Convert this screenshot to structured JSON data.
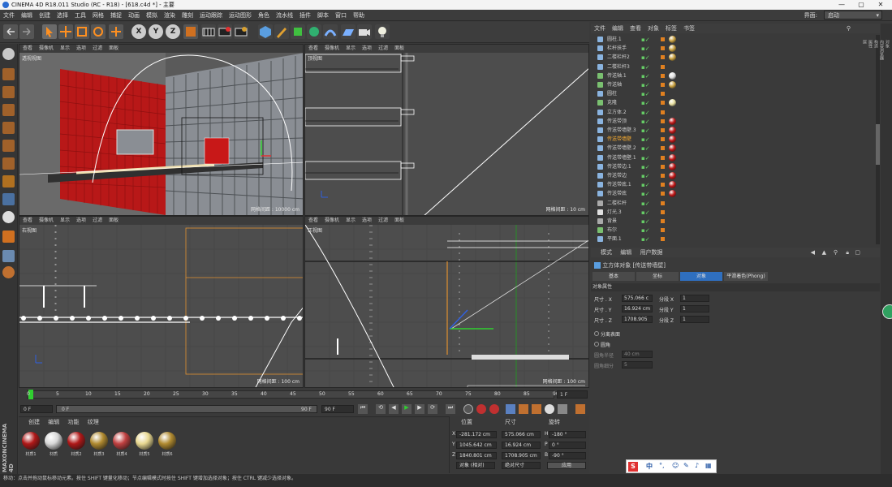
{
  "window": {
    "title": "CINEMA 4D R18.011 Studio (RC - R18) - [618.c4d *] - 主要",
    "min": "—",
    "max": "▢",
    "close": "✕"
  },
  "menu": [
    "文件",
    "编辑",
    "创建",
    "选择",
    "工具",
    "网格",
    "捕捉",
    "动画",
    "模拟",
    "渲染",
    "雕刻",
    "运动跟踪",
    "运动图形",
    "角色",
    "流水线",
    "插件",
    "脚本",
    "窗口",
    "帮助"
  ],
  "layout": {
    "label": "界面:",
    "value": "启动"
  },
  "toolbar": {
    "axis_x": "X",
    "axis_y": "Y",
    "axis_z": "Z"
  },
  "viewports": {
    "persp": {
      "menu": [
        "查看",
        "摄像机",
        "显示",
        "选项",
        "过滤",
        "面板"
      ],
      "label": "透视视图",
      "grid": "网格间距 : 10000 cm"
    },
    "top": {
      "menu": [
        "查看",
        "摄像机",
        "显示",
        "选项",
        "过滤",
        "面板"
      ],
      "label": "顶视图",
      "grid": "网格间距 : 10 cm"
    },
    "right": {
      "menu": [
        "查看",
        "摄像机",
        "显示",
        "选项",
        "过滤",
        "面板"
      ],
      "label": "右视图",
      "grid": "网格间距 : 100 cm"
    },
    "front": {
      "menu": [
        "查看",
        "摄像机",
        "显示",
        "选项",
        "过滤",
        "面板"
      ],
      "label": "正视图",
      "grid": "网格间距 : 100 cm"
    }
  },
  "timeline": {
    "ticks": [
      "0",
      "5",
      "10",
      "15",
      "20",
      "25",
      "30",
      "35",
      "40",
      "45",
      "50",
      "55",
      "60",
      "65",
      "70",
      "75",
      "80",
      "85",
      "90"
    ],
    "current": "1 F"
  },
  "frames": {
    "start": "0 F",
    "range_start": "0 F",
    "range_end": "90 F",
    "end": "90 F"
  },
  "materials": {
    "menu": [
      "创建",
      "编辑",
      "功能",
      "纹理"
    ],
    "items": [
      {
        "name": "材质1",
        "color": "#b01818"
      },
      {
        "name": "材质",
        "color": "#d8d8d8"
      },
      {
        "name": "材质2",
        "color": "#b01818"
      },
      {
        "name": "材质3",
        "color": "#b08a30"
      },
      {
        "name": "材质4",
        "color": "#c04040"
      },
      {
        "name": "材质5",
        "color": "#e8d890"
      },
      {
        "name": "材质6",
        "color": "#b08a30"
      }
    ]
  },
  "coords": {
    "headers": [
      "位置",
      "尺寸",
      "旋转"
    ],
    "rows": [
      {
        "axis": "X",
        "pos": "-281.172 cm",
        "size": "575.066 cm",
        "rl": "H",
        "rot": "-180 °"
      },
      {
        "axis": "Y",
        "pos": "1045.642 cm",
        "size": "16.924 cm",
        "rl": "P",
        "rot": "0 °"
      },
      {
        "axis": "Z",
        "pos": "1840.801 cm",
        "size": "1708.905 cm",
        "rl": "B",
        "rot": "-90 °"
      }
    ],
    "mode1": "对象 (相对)",
    "mode2": "绝对尺寸",
    "apply": "应用"
  },
  "objmgr": {
    "menu": [
      "文件",
      "编辑",
      "查看",
      "对象",
      "标签",
      "书签"
    ],
    "rows": [
      {
        "name": "圆柱.1",
        "color": "#8ab4e0",
        "hl": false,
        "tags": [
          "#c8a040"
        ]
      },
      {
        "name": "栏杆扶手",
        "color": "#8ab4e0",
        "hl": false,
        "tags": [
          "#c8a040"
        ]
      },
      {
        "name": "二楼栏杆2",
        "color": "#8ab4e0",
        "hl": false,
        "tags": [
          "#c8a040"
        ]
      },
      {
        "name": "二楼栏杆3",
        "color": "#8ab4e0",
        "hl": false,
        "tags": []
      },
      {
        "name": "传送轴.1",
        "color": "#7ac070",
        "hl": false,
        "tags": [
          "#e0e0e0"
        ]
      },
      {
        "name": "传送轴",
        "color": "#7ac070",
        "hl": false,
        "tags": [
          "#c8a040"
        ]
      },
      {
        "name": "圆柱",
        "color": "#8ab4e0",
        "hl": false,
        "tags": []
      },
      {
        "name": "克隆",
        "color": "#7ac070",
        "hl": false,
        "tags": [
          "#e8e0a0"
        ]
      },
      {
        "name": "立方体.2",
        "color": "#8ab4e0",
        "hl": false,
        "tags": []
      },
      {
        "name": "传送带顶",
        "color": "#8ab4e0",
        "hl": false,
        "tags": [
          "#c01818"
        ]
      },
      {
        "name": "传送带墙壁.3",
        "color": "#8ab4e0",
        "hl": false,
        "tags": [
          "#c01818"
        ]
      },
      {
        "name": "传送带墙壁",
        "color": "#8ab4e0",
        "hl": true,
        "tags": [
          "#c01818"
        ]
      },
      {
        "name": "传送带墙壁.2",
        "color": "#8ab4e0",
        "hl": false,
        "tags": [
          "#c01818"
        ]
      },
      {
        "name": "传送带墙壁.1",
        "color": "#8ab4e0",
        "hl": false,
        "tags": [
          "#c01818"
        ]
      },
      {
        "name": "传送带边.1",
        "color": "#8ab4e0",
        "hl": false,
        "tags": [
          "#c01818"
        ]
      },
      {
        "name": "传送带边",
        "color": "#8ab4e0",
        "hl": false,
        "tags": [
          "#c01818"
        ]
      },
      {
        "name": "传送带底.1",
        "color": "#8ab4e0",
        "hl": false,
        "tags": [
          "#c01818"
        ]
      },
      {
        "name": "传送带底",
        "color": "#8ab4e0",
        "hl": false,
        "tags": [
          "#c01818"
        ]
      },
      {
        "name": "二楼栏杆",
        "color": "#aaaaaa",
        "hl": false,
        "tags": []
      },
      {
        "name": "灯光.3",
        "color": "#e0e0e0",
        "hl": false,
        "tags": []
      },
      {
        "name": "背景",
        "color": "#aaaaaa",
        "hl": false,
        "tags": []
      },
      {
        "name": "布尔",
        "color": "#7ac070",
        "hl": false,
        "tags": []
      },
      {
        "name": "平面.1",
        "color": "#8ab4e0",
        "hl": false,
        "tags": []
      }
    ]
  },
  "attrmgr": {
    "menu": [
      "模式",
      "编辑",
      "用户数据"
    ],
    "title": "立方体对象 [传送带墙壁]",
    "tabs": [
      "基本",
      "坐标",
      "对象",
      "平滑着色(Phong)"
    ],
    "active_tab": "对象",
    "section": "对象属性",
    "props": [
      {
        "label": "尺寸 . X",
        "value": "575.066 c",
        "seg_label": "分段 X",
        "seg": "1"
      },
      {
        "label": "尺寸 . Y",
        "value": "16.924 cm",
        "seg_label": "分段 Y",
        "seg": "1"
      },
      {
        "label": "尺寸 . Z",
        "value": "1708.905",
        "seg_label": "分段 Z",
        "seg": "1"
      }
    ],
    "separate": "分离表面",
    "fillet": "圆角",
    "fillet_radius_label": "圆角半径",
    "fillet_radius": "40 cm",
    "fillet_sub_label": "圆角细分",
    "fillet_sub": "5"
  },
  "status": "移动：点击并拖动鼠标移动元素。按住 SHIFT 键量化移动；节点编辑模式时按住 SHIFT 键增加选择对象；按住 CTRL 键减少选择对象。",
  "ime": {
    "label": "中"
  },
  "right_tabs": [
    "对象",
    "内容浏览器",
    "构造",
    "属性",
    "层"
  ],
  "brand": {
    "line1": "MAXON",
    "line2": "CINEMA 4D"
  }
}
